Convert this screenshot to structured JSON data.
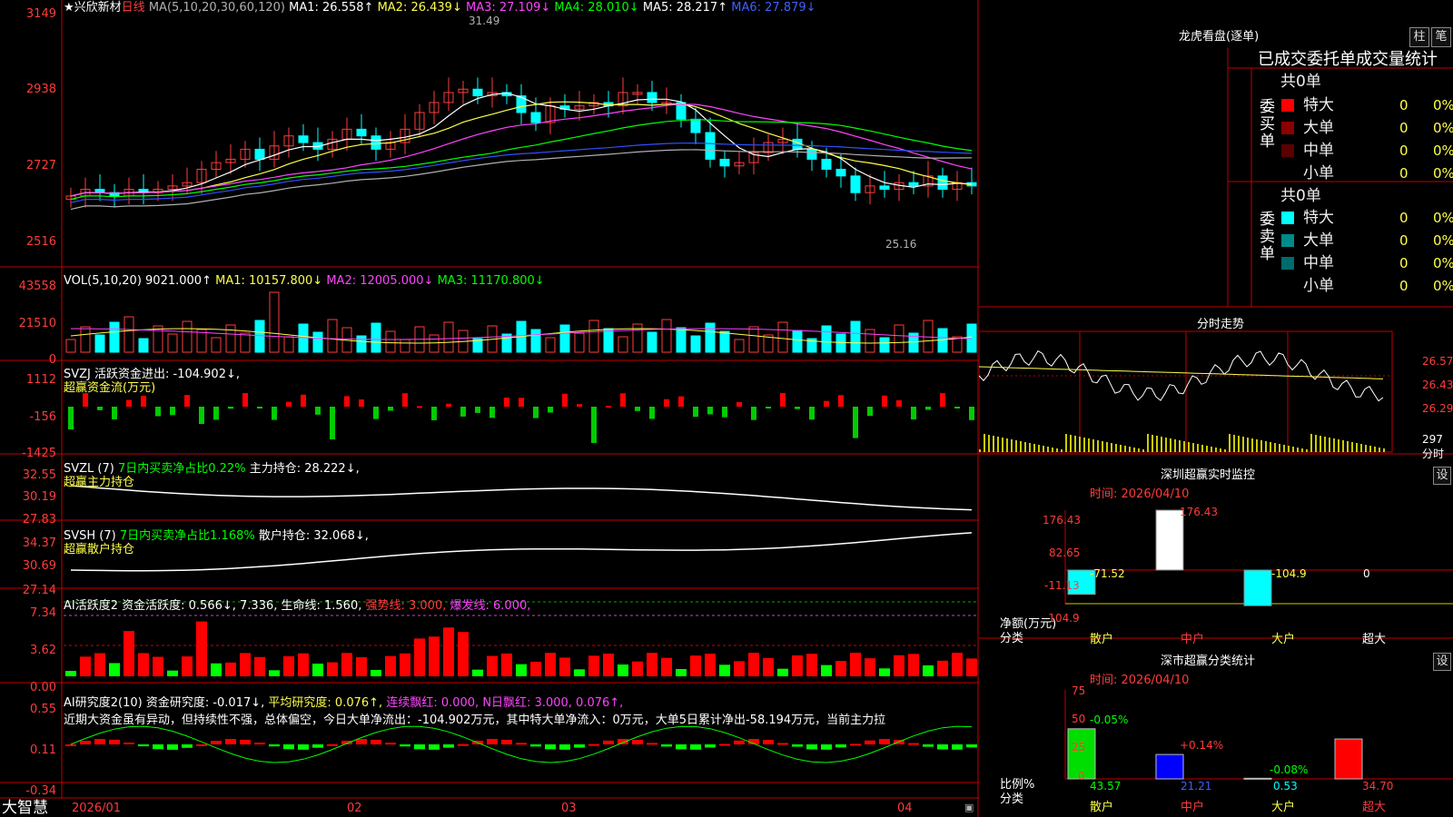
{
  "main": {
    "ticks": [
      "3149",
      "2938",
      "2727",
      "2516"
    ],
    "stock_name": "兴欣新材",
    "period": "日线",
    "ma_params": "MA(5,10,20,30,60,120)",
    "ma": [
      {
        "label": "MA1: 26.558↑",
        "color": "#ffffff"
      },
      {
        "label": "MA2: 26.439↓",
        "color": "#ffff4a"
      },
      {
        "label": "MA3: 27.109↓",
        "color": "#ff44ff"
      },
      {
        "label": "MA4: 28.010↓",
        "color": "#00ff00"
      },
      {
        "label": "MA5: 28.217↑",
        "color": "#ffffff"
      },
      {
        "label": "MA6: 27.879↓",
        "color": "#4060ff"
      }
    ],
    "high_mark": "31.49",
    "low_mark": "25.16"
  },
  "vol": {
    "ticks": [
      "43558",
      "21510",
      "0"
    ],
    "label": "VOL(5,10,20) 9021.000↑",
    "ma": [
      {
        "label": "MA1: 10157.800↓",
        "color": "#ffff4a"
      },
      {
        "label": "MA2: 12005.000↓",
        "color": "#ff44ff"
      },
      {
        "label": "MA3: 11170.800↓",
        "color": "#00ff00"
      }
    ]
  },
  "svzj": {
    "ticks": [
      "1112",
      "-156",
      "-1425"
    ],
    "label": "SVZJ  活跃资金进出: -104.902↓,",
    "sub": "超赢资金流(万元)"
  },
  "svzl": {
    "ticks": [
      "32.55",
      "30.19",
      "27.83"
    ],
    "label_a": "SVZL (7)",
    "label_b": "7日内买卖净占比0.22%",
    "label_c": "主力持仓: 28.222↓,",
    "sub": "超赢主力持仓"
  },
  "svsh": {
    "ticks": [
      "34.37",
      "30.69",
      "27.14"
    ],
    "label_a": "SVSH (7)",
    "label_b": "7日内买卖净占比1.168%",
    "label_c": "散户持仓: 32.068↓,",
    "sub": "超赢散户持仓"
  },
  "ai1": {
    "ticks": [
      "7.34",
      "3.62",
      "0.00"
    ],
    "label_a": "AI活跃度2 资金活跃度: 0.566↓, 7.336, 生命线: 1.560,",
    "label_b": "强势线: 3.000,",
    "label_c": "爆发线: 6.000,"
  },
  "ai2": {
    "ticks": [
      "0.55",
      "0.11",
      "-0.34"
    ],
    "label_a": "AI研究度2(10) 资金研究度: -0.017↓,",
    "label_b": "平均研究度: 0.076↑,",
    "label_c": "连续飘红: 0.000,",
    "label_d": "N日飘红: 3.000, 0.076↑,",
    "commentary": "近期大资金虽有异动，但持续性不强，总体偏空，今日大单净流出：-104.902万元，其中特大单净流入：0万元，大单5日累计净出-58.194万元，当前主力拉"
  },
  "footer": {
    "brand": "大智慧",
    "dates": [
      "2026/01",
      "02",
      "03",
      "04"
    ]
  },
  "right": {
    "title": "龙虎看盘(逐单)",
    "btn_bar": "柱",
    "btn_tick": "笔",
    "stats_title": "已成交委托单成交量统计",
    "buy_side": "委买单",
    "sell_side": "委卖单",
    "buy_total": "共0单",
    "sell_total": "共0单",
    "levels": [
      "特大",
      "大单",
      "中单",
      "小单"
    ],
    "buy_values": [
      "0",
      "0",
      "0",
      "0"
    ],
    "sell_values": [
      "0",
      "0",
      "0",
      "0"
    ],
    "buy_pct": [
      "0%",
      "0%",
      "0%",
      "0%"
    ],
    "sell_pct": [
      "0%",
      "0%",
      "0%",
      "0%"
    ],
    "intraday_title": "分时走势",
    "intraday_ticks": [
      "26.57",
      "26.43",
      "26.29"
    ],
    "intraday_vol": "297",
    "intraday_unit": "分时",
    "monitor_title": "深圳超赢实时监控",
    "monitor_btn": "设",
    "monitor_time": "时间: 2026/04/10",
    "monitor_ticks": [
      "176.43",
      "82.65",
      "-11.13",
      "-104.9"
    ],
    "monitor_values": [
      "-71.52",
      "176.43",
      "-104.9",
      "0"
    ],
    "monitor_ylabel": "净额(万元)",
    "monitor_xlabel": "分类",
    "categories": [
      "散户",
      "中户",
      "大户",
      "超大"
    ],
    "class_title": "深市超赢分类统计",
    "class_btn": "设",
    "class_time": "时间: 2026/04/10",
    "class_ticks": [
      "75",
      "50",
      "25",
      "0"
    ],
    "class_changes": [
      "-0.05%",
      "+0.14%",
      "-0.08%",
      ""
    ],
    "class_values": [
      "43.57",
      "21.21",
      "0.53",
      "34.70"
    ],
    "class_ylabel": "比例%",
    "class_xlabel": "分类"
  },
  "chart_data": {
    "type": "candlestick",
    "x": [
      "2026/01",
      "02",
      "03",
      "04"
    ],
    "candles": {
      "open": [
        26.1,
        26.2,
        26.4,
        26.3,
        26.2,
        26.4,
        26.3,
        26.4,
        26.5,
        26.6,
        27.0,
        27.2,
        27.3,
        27.6,
        27.3,
        27.7,
        28.0,
        27.8,
        27.6,
        27.9,
        28.2,
        28.0,
        27.6,
        27.8,
        28.2,
        28.7,
        29.0,
        29.3,
        29.4,
        29.2,
        29.3,
        29.2,
        28.7,
        28.4,
        28.9,
        28.8,
        28.9,
        29.0,
        28.9,
        29.3,
        29.3,
        29.0,
        29.0,
        28.5,
        28.1,
        27.3,
        27.1,
        27.2,
        27.5,
        27.8,
        27.9,
        27.6,
        27.3,
        27.0,
        26.8,
        26.3,
        26.5,
        26.4,
        26.6,
        26.5,
        26.8,
        26.4,
        26.6
      ],
      "close": [
        26.2,
        26.4,
        26.3,
        26.2,
        26.4,
        26.3,
        26.4,
        26.5,
        26.6,
        27.0,
        27.2,
        27.3,
        27.6,
        27.3,
        27.7,
        28.0,
        27.8,
        27.6,
        27.9,
        28.2,
        28.0,
        27.6,
        27.8,
        28.2,
        28.7,
        29.0,
        29.3,
        29.4,
        29.2,
        29.3,
        29.2,
        28.7,
        28.4,
        28.9,
        28.8,
        28.9,
        29.0,
        28.9,
        29.3,
        29.3,
        29.0,
        29.0,
        28.5,
        28.1,
        27.3,
        27.1,
        27.2,
        27.5,
        27.8,
        27.9,
        27.6,
        27.3,
        27.0,
        26.8,
        26.3,
        26.5,
        26.4,
        26.6,
        26.5,
        26.8,
        26.4,
        26.6,
        26.5
      ],
      "high_label": 31.49,
      "low_label": 25.16
    },
    "volume_axis": [
      0,
      21510,
      43558
    ],
    "intraday_axis": [
      26.29,
      26.43,
      26.57
    ],
    "monitor": {
      "categories": [
        "散户",
        "中户",
        "大户",
        "超大"
      ],
      "values": [
        -71.52,
        176.43,
        -104.9,
        0
      ]
    },
    "classification": {
      "categories": [
        "散户",
        "中户",
        "大户",
        "超大"
      ],
      "values": [
        43.57,
        21.21,
        0.53,
        34.7
      ],
      "changes": [
        "-0.05%",
        "+0.14%",
        "-0.08%",
        ""
      ]
    }
  }
}
